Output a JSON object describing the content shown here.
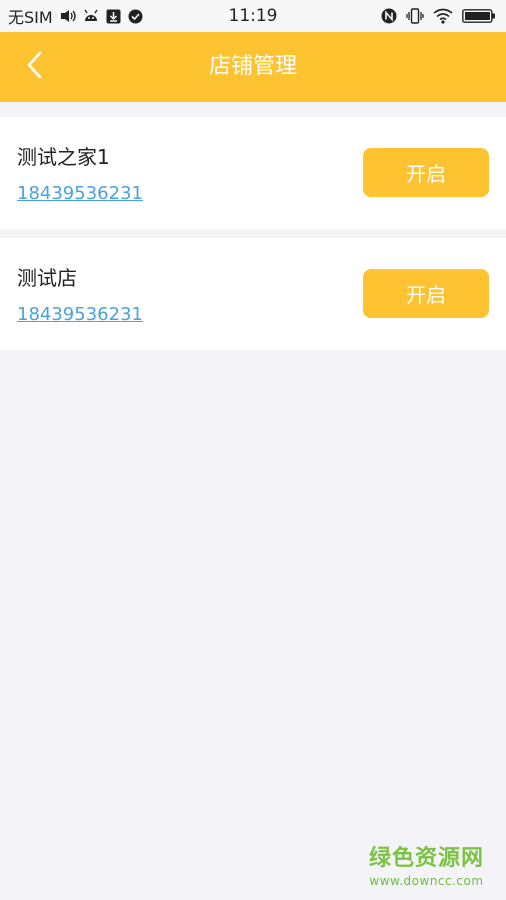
{
  "status_bar": {
    "carrier": "无SIM",
    "time": "11:19"
  },
  "header": {
    "title": "店铺管理"
  },
  "stores": [
    {
      "name": "测试之家1",
      "phone": "18439536231",
      "button_label": "开启"
    },
    {
      "name": "测试店",
      "phone": "18439536231",
      "button_label": "开启"
    }
  ],
  "watermark": {
    "main": "绿色资源网",
    "sub": "www.downcc.com"
  },
  "colors": {
    "accent": "#fec331",
    "link": "#4aa2de",
    "background": "#f4f4f8"
  }
}
